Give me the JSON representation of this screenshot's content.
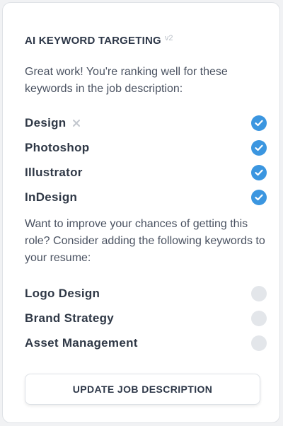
{
  "header": {
    "title": "AI KEYWORD TARGETING",
    "version": "v2"
  },
  "intro_text": "Great work! You're ranking well for these keywords in the job description:",
  "matched_keywords": [
    {
      "label": "Design",
      "removable": true,
      "status": "matched"
    },
    {
      "label": "Photoshop",
      "status": "matched"
    },
    {
      "label": "Illustrator",
      "status": "matched"
    },
    {
      "label": "InDesign",
      "status": "matched"
    }
  ],
  "suggest_text": "Want to improve your chances of getting this role? Consider adding the following keywords to your resume:",
  "missing_keywords": [
    {
      "label": "Logo Design",
      "status": "missing"
    },
    {
      "label": "Brand Strategy",
      "status": "missing"
    },
    {
      "label": "Asset Management",
      "status": "missing"
    }
  ],
  "update_button": {
    "label": "UPDATE JOB DESCRIPTION"
  },
  "colors": {
    "accent": "#3b96e0",
    "empty_dot": "#e3e6ea",
    "text": "#2f3846"
  }
}
